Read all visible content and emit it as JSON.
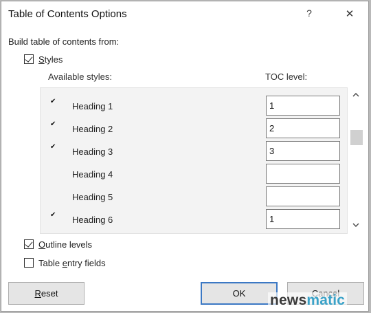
{
  "dialog": {
    "title": "Table of Contents Options",
    "help_label": "?",
    "close_label": "✕"
  },
  "build_label": "Build table of contents from:",
  "styles_checkbox": {
    "label": "Styles",
    "checked": true
  },
  "columns": {
    "available_styles": "Available styles:",
    "toc_level": "TOC level:"
  },
  "styles": [
    {
      "name": "Heading 1",
      "checked": true,
      "level": "1"
    },
    {
      "name": "Heading 2",
      "checked": true,
      "level": "2"
    },
    {
      "name": "Heading 3",
      "checked": true,
      "level": "3"
    },
    {
      "name": "Heading 4",
      "checked": false,
      "level": ""
    },
    {
      "name": "Heading 5",
      "checked": false,
      "level": ""
    },
    {
      "name": "Heading 6",
      "checked": true,
      "level": "1"
    }
  ],
  "outline_levels": {
    "label": "Outline levels",
    "checked": true
  },
  "table_entry_fields": {
    "label": "Table entry fields",
    "checked": false
  },
  "buttons": {
    "reset": "Reset",
    "ok": "OK",
    "cancel": "Cancel"
  },
  "watermark": {
    "part1": "news",
    "part2": "matic"
  },
  "colors": {
    "ok_border": "#3b78c4",
    "box_bg": "#f3f3f3",
    "watermark_accent": "#3aa2c8"
  }
}
